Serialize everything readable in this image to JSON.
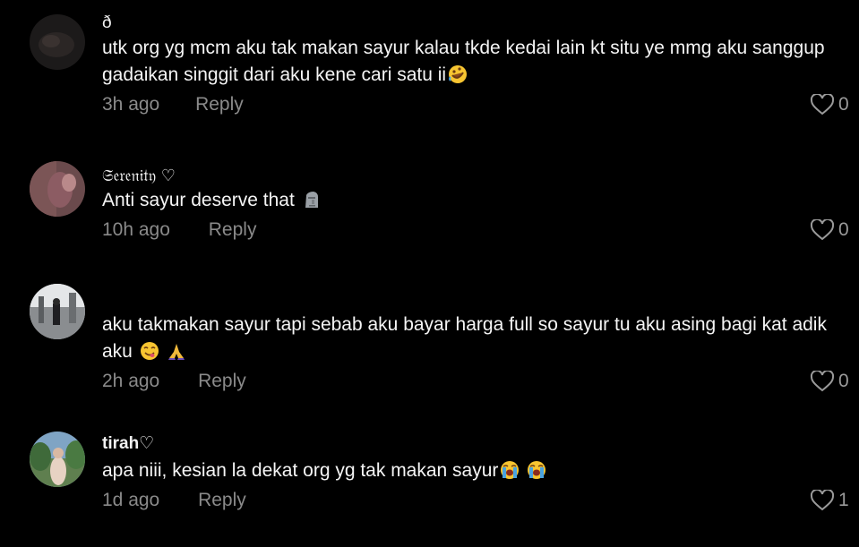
{
  "comments": [
    {
      "username": "ð",
      "text": "utk org yg mcm aku tak makan sayur kalau tkde kedai lain kt situ ye mmg aku sanggup gadaikan singgit dari aku kene cari satu ii",
      "emojis": [
        "rolling-laughing-face"
      ],
      "time": "3h ago",
      "reply_label": "Reply",
      "like_count": "0"
    },
    {
      "username": "𝔖𝔢𝔯𝔢𝔫𝔦𝔱𝔶 ♡",
      "text": "Anti sayur deserve that",
      "emojis": [
        "moai-stone-face"
      ],
      "time": "10h ago",
      "reply_label": "Reply",
      "like_count": "0"
    },
    {
      "username": "",
      "text": "aku takmakan sayur tapi sebab aku bayar harga full so sayur tu aku asing bagi kat adik aku",
      "emojis": [
        "face-savoring-food",
        "folded-hands"
      ],
      "time": "2h ago",
      "reply_label": "Reply",
      "like_count": "0"
    },
    {
      "username": "tirah♡",
      "text": "apa niii, kesian la dekat org yg tak makan sayur",
      "emojis": [
        "loudly-crying-face",
        "loudly-crying-face"
      ],
      "time": "1d ago",
      "reply_label": "Reply",
      "like_count": "1"
    }
  ],
  "colors": {
    "background": "#000000",
    "text": "#f5f5f5",
    "meta": "#8a8a8a"
  },
  "icons": {
    "like": "heart-outline-icon"
  }
}
